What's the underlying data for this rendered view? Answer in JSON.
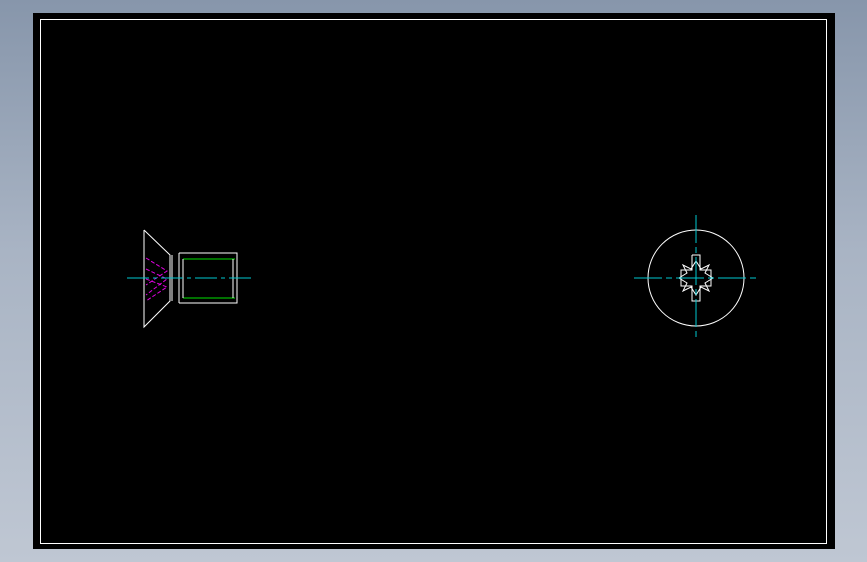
{
  "colors": {
    "background": "#000000",
    "outline": "#ffffff",
    "center_line": "#00c8d0",
    "hidden_line": "#e000e0",
    "thread_line": "#00e000"
  },
  "views": {
    "side": "countersunk-screw-side-view",
    "end": "screw-head-end-view"
  }
}
